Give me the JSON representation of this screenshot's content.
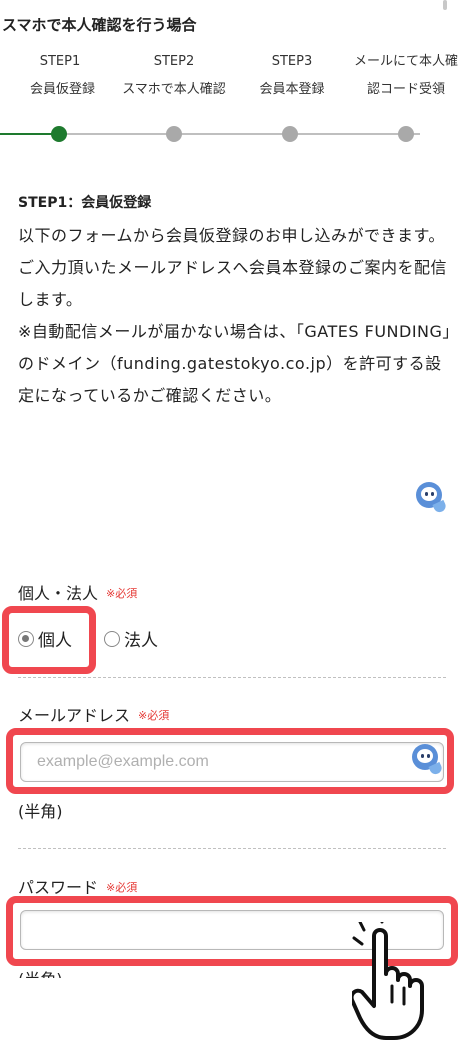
{
  "section_title": "スマホで本人確認を行う場合",
  "steps": [
    {
      "num": "STEP1",
      "label": "会員仮登録"
    },
    {
      "num": "STEP2",
      "label": "スマホで本人確認"
    },
    {
      "num": "STEP3",
      "label": "会員本登録"
    },
    {
      "num": "メールにて本人確",
      "label": "認コード受領"
    }
  ],
  "progress": {
    "current_step": 1,
    "total_steps": 4
  },
  "intro": {
    "heading": "STEP1：会員仮登録",
    "paragraphs": [
      "以下のフォームから会員仮登録のお申し込みができます。",
      "ご入力頂いたメールアドレスへ会員本登録のご案内を配信します。",
      "※自動配信メールが届かない場合は、「GATES FUNDING」のドメイン（funding.gatestokyo.co.jp）を許可する設定になっているかご確認ください。"
    ]
  },
  "form": {
    "type_field": {
      "label": "個人・法人",
      "required": "※必須",
      "options": [
        "個人",
        "法人"
      ],
      "selected": "個人"
    },
    "email_field": {
      "label": "メールアドレス",
      "required": "※必須",
      "placeholder": "example@example.com",
      "value": "",
      "hint": "(半角)"
    },
    "password_field": {
      "label": "パスワード",
      "required": "※必須",
      "value": "",
      "hint": "(半角)"
    }
  },
  "colors": {
    "accent_green": "#1e7a2e",
    "highlight_red": "#f0474f",
    "required_red": "#e53935",
    "inactive_gray": "#a9a9a9"
  }
}
